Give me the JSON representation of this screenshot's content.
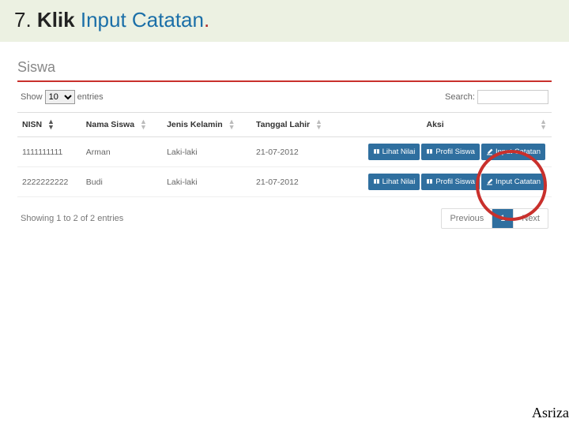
{
  "slide": {
    "number": "7.",
    "word_klik": "Klik",
    "word_link": "Input Catatan",
    "dot": "."
  },
  "panel_title": "Siswa",
  "controls": {
    "show_label": "Show",
    "entries_label": "entries",
    "page_size": "10",
    "search_label": "Search:",
    "search_value": ""
  },
  "columns": {
    "nisn": "NISN",
    "nama": "Nama Siswa",
    "jk": "Jenis Kelamin",
    "tgl": "Tanggal Lahir",
    "aksi": "Aksi"
  },
  "buttons": {
    "lihat_nilai": "Lihat Nilai",
    "profil_siswa": "Profil Siswa",
    "input_catatan": "Input Catatan"
  },
  "rows": [
    {
      "nisn": "1111111111",
      "nama": "Arman",
      "jk": "Laki-laki",
      "tgl": "21-07-2012"
    },
    {
      "nisn": "2222222222",
      "nama": "Budi",
      "jk": "Laki-laki",
      "tgl": "21-07-2012"
    }
  ],
  "footer": {
    "info": "Showing 1 to 2 of 2 entries",
    "prev": "Previous",
    "page": "1",
    "next": "Next"
  },
  "author": "Asriza"
}
